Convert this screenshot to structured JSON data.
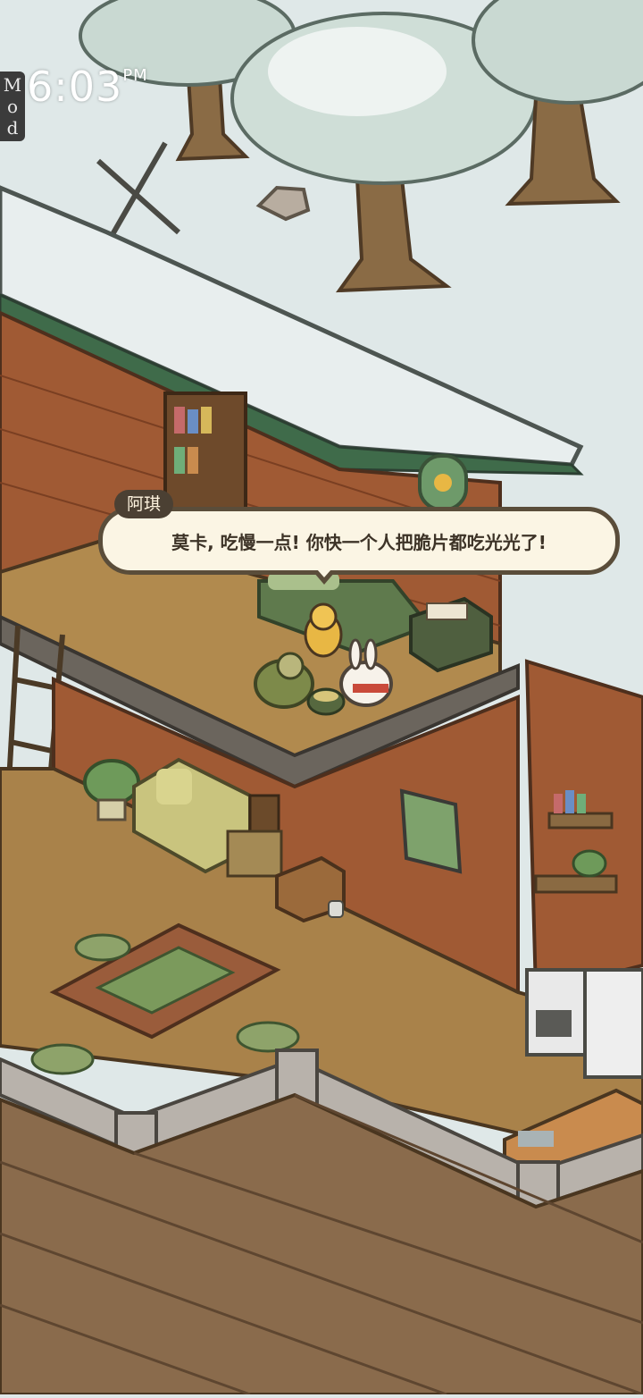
{
  "status": {
    "mod_badge": "Mod",
    "mod_letters": [
      "M",
      "o",
      "d"
    ],
    "time": "6:03",
    "ampm": "PM"
  },
  "dialog": {
    "speaker": "阿琪",
    "text": "莫卡, 吃慢一点! 你快一个人把脆片都吃光光了!"
  },
  "scene": {
    "season": "winter",
    "snow_color": "#e3ecea",
    "wood_color": "#a87e49",
    "brick_color": "#a05a34",
    "roof_trim_color": "#3f6b4a"
  }
}
